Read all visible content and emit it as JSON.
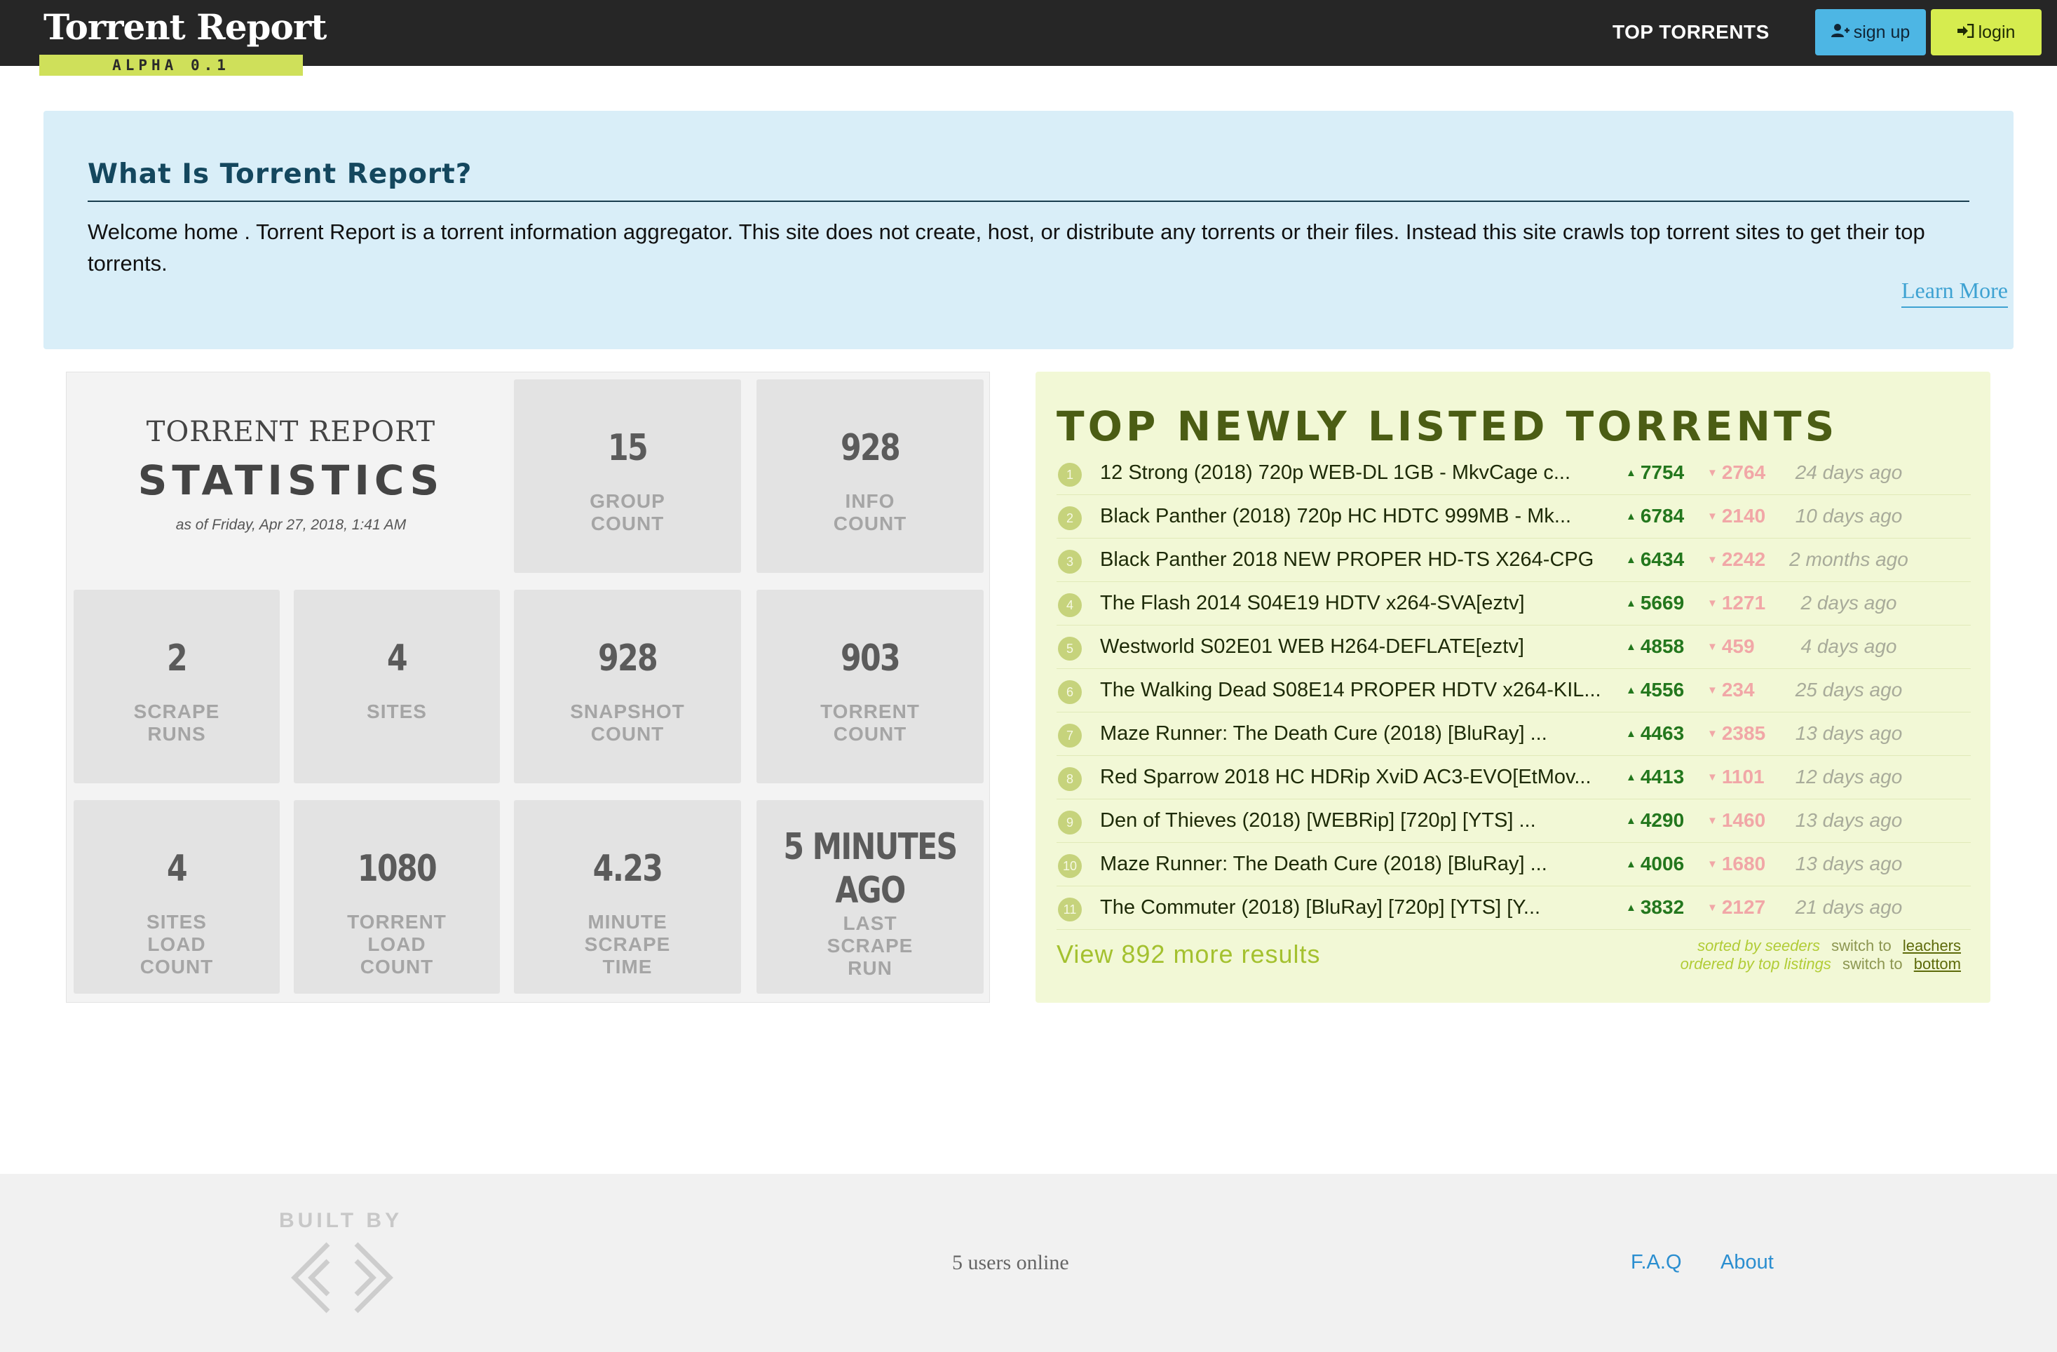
{
  "header": {
    "brand_title": "Torrent Report",
    "brand_tag": "ALPHA 0.1",
    "nav_link": "TOP TORRENTS",
    "signup_label": "sign up",
    "login_label": "login"
  },
  "intro": {
    "title": "What Is Torrent Report?",
    "text": "Welcome home . Torrent Report is a torrent information aggregator. This site does not create, host, or distribute any torrents or their files. Instead this site crawls top torrent sites to get their top torrents.",
    "learn_more": "Learn More"
  },
  "stats": {
    "heading_line1": "TORRENT REPORT",
    "heading_line2": "STATISTICS",
    "as_of": "as of Friday, Apr 27, 2018, 1:41 AM",
    "tiles": [
      {
        "value": "15",
        "label": "GROUP\nCOUNT"
      },
      {
        "value": "928",
        "label": "INFO\nCOUNT"
      },
      {
        "value": "2",
        "label": "SCRAPE\nRUNS"
      },
      {
        "value": "4",
        "label": "SITES"
      },
      {
        "value": "928",
        "label": "SNAPSHOT\nCOUNT"
      },
      {
        "value": "903",
        "label": "TORRENT\nCOUNT"
      },
      {
        "value": "4",
        "label": "SITES\nLOAD\nCOUNT"
      },
      {
        "value": "1080",
        "label": "TORRENT\nLOAD\nCOUNT"
      },
      {
        "value": "4.23",
        "label": "MINUTE\nSCRAPE\nTIME"
      },
      {
        "value": "5 MINUTES AGO",
        "label": "LAST\nSCRAPE\nRUN"
      }
    ]
  },
  "top": {
    "title": "TOP NEWLY LISTED TORRENTS",
    "rows": [
      {
        "rank": "1",
        "name": "12 Strong (2018) 720p WEB-DL 1GB - MkvCage c...",
        "seeders": "7754",
        "leechers": "2764",
        "age": "24 days ago"
      },
      {
        "rank": "2",
        "name": "Black Panther (2018) 720p HC HDTC 999MB - Mk...",
        "seeders": "6784",
        "leechers": "2140",
        "age": "10 days ago"
      },
      {
        "rank": "3",
        "name": "Black Panther 2018 NEW PROPER HD-TS X264-CPG",
        "seeders": "6434",
        "leechers": "2242",
        "age": "2 months ago"
      },
      {
        "rank": "4",
        "name": "The Flash 2014 S04E19 HDTV x264-SVA[eztv]",
        "seeders": "5669",
        "leechers": "1271",
        "age": "2 days ago"
      },
      {
        "rank": "5",
        "name": "Westworld S02E01 WEB H264-DEFLATE[eztv]",
        "seeders": "4858",
        "leechers": "459",
        "age": "4 days ago"
      },
      {
        "rank": "6",
        "name": "The Walking Dead S08E14 PROPER HDTV x264-KIL...",
        "seeders": "4556",
        "leechers": "234",
        "age": "25 days ago"
      },
      {
        "rank": "7",
        "name": "Maze Runner: The Death Cure (2018) [BluRay] ...",
        "seeders": "4463",
        "leechers": "2385",
        "age": "13 days ago"
      },
      {
        "rank": "8",
        "name": "Red Sparrow 2018 HC HDRip XviD AC3-EVO[EtMov...",
        "seeders": "4413",
        "leechers": "1101",
        "age": "12 days ago"
      },
      {
        "rank": "9",
        "name": "Den of Thieves (2018) [WEBRip] [720p] [YTS] ...",
        "seeders": "4290",
        "leechers": "1460",
        "age": "13 days ago"
      },
      {
        "rank": "10",
        "name": "Maze Runner: The Death Cure (2018) [BluRay] ...",
        "seeders": "4006",
        "leechers": "1680",
        "age": "13 days ago"
      },
      {
        "rank": "11",
        "name": "The Commuter (2018) [BluRay] [720p] [YTS] [Y...",
        "seeders": "3832",
        "leechers": "2127",
        "age": "21 days ago"
      }
    ],
    "view_more": "View 892 more results",
    "sorted_by": "sorted by seeders",
    "ordered_by": "ordered by top listings",
    "switch_to": "switch to",
    "switch_leechers": "leachers",
    "switch_bottom": "bottom"
  },
  "footer": {
    "built_by": "BUILT BY",
    "users_online": "5 users online",
    "faq": "F.A.Q",
    "about": "About"
  },
  "colors": {
    "navbar": "#262626",
    "brand_tag": "#cfe05a",
    "signup": "#4db6e4",
    "login": "#d6ec4f",
    "info_bg": "#d9eef8",
    "top_bg": "#f2f8d6",
    "seeders": "#23771d",
    "leechers": "#f1a7a7"
  },
  "icons": {
    "signup": "user-plus-icon",
    "login": "sign-in-icon",
    "seeders": "triangle-up-icon",
    "leechers": "triangle-down-icon",
    "footer_logo": "code-brackets-icon"
  }
}
